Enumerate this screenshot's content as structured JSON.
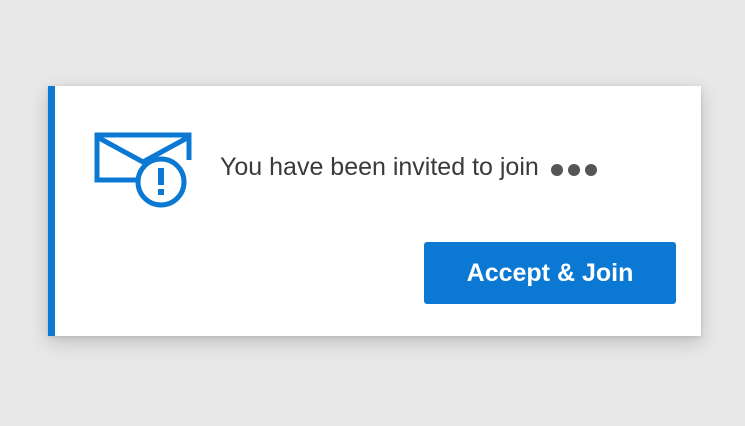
{
  "notification": {
    "message": "You have been invited to join",
    "accept_button_label": "Accept & Join",
    "icon": "envelope-alert-icon",
    "truncation_indicator": "more-dots-icon",
    "accent_color": "#0b78d4",
    "text_color": "#3a3a3a",
    "background_color": "#e8e8e8"
  }
}
